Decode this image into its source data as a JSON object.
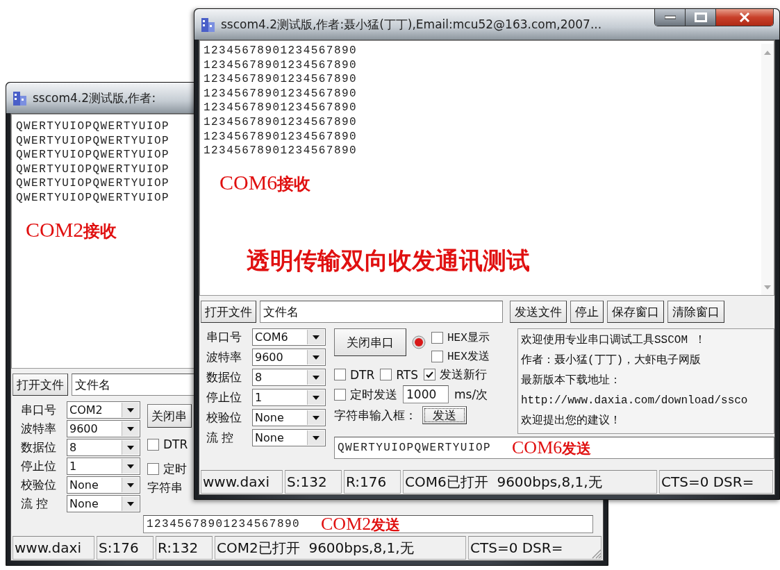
{
  "back_window": {
    "title": "sscom4.2测试版,作者:",
    "receive_lines": [
      "QWERTYUIOPQWERTYUIOP",
      "QWERTYUIOPQWERTYUIOP",
      "QWERTYUIOPQWERTYUIOP",
      "QWERTYUIOPQWERTYUIOP",
      "QWERTYUIOPQWERTYUIOP",
      "QWERTYUIOPQWERTYUIOP"
    ],
    "receive_note": "COM2**接收**",
    "open_file_button": "打开文件",
    "file_name": "文件名",
    "settings": [
      {
        "label": "串口号",
        "value": "COM2"
      },
      {
        "label": "波特率",
        "value": "9600"
      },
      {
        "label": "数据位",
        "value": "8"
      },
      {
        "label": "停止位",
        "value": "1"
      },
      {
        "label": "校验位",
        "value": "None"
      },
      {
        "label": "流 控",
        "value": "None"
      }
    ],
    "close_port_button": "关闭串",
    "checkboxes": [
      {
        "label": "DTR",
        "checked": false
      },
      {
        "label": "定时",
        "checked": false
      }
    ],
    "string_input_label": "字符串",
    "send_text": "12345678901234567890",
    "send_note": "COM2**发送**",
    "status": [
      "www.daxi",
      "S:176",
      "R:132",
      "COM2已打开  9600bps,8,1,无",
      "CTS=0 DSR="
    ]
  },
  "front_window": {
    "title": "sscom4.2测试版,作者:聂小猛(丁丁),Email:mcu52@163.com,2007...",
    "receive_lines": [
      "12345678901234567890",
      "12345678901234567890",
      "12345678901234567890",
      "12345678901234567890",
      "12345678901234567890",
      "12345678901234567890",
      "12345678901234567890",
      "12345678901234567890"
    ],
    "receive_note": "COM6**接收**",
    "banner": "透明传输双向收发通讯测试",
    "open_file_button": "打开文件",
    "file_name": "文件名",
    "file_buttons": [
      "发送文件",
      "停止",
      "保存窗口",
      "清除窗口"
    ],
    "settings": [
      {
        "label": "串口号",
        "value": "COM6"
      },
      {
        "label": "波特率",
        "value": "9600"
      },
      {
        "label": "数据位",
        "value": "8"
      },
      {
        "label": "停止位",
        "value": "1"
      },
      {
        "label": "校验位",
        "value": "None"
      },
      {
        "label": "流 控",
        "value": "None"
      }
    ],
    "close_port_button": "关闭串口",
    "port_open": true,
    "checkboxes": [
      {
        "label": "HEX显示",
        "checked": false
      },
      {
        "label": "HEX发送",
        "checked": false
      },
      {
        "label": "DTR",
        "checked": false
      },
      {
        "label": "RTS",
        "checked": false
      },
      {
        "label": "发送新行",
        "checked": true
      },
      {
        "label": "定时发送",
        "checked": false
      }
    ],
    "interval": "1000",
    "interval_unit": "ms/次",
    "string_input_label": "字符串输入框：",
    "send_button": "发送",
    "info_lines": [
      "欢迎使用专业串口调试工具SSCOM ！",
      "作者：聂小猛(丁丁)，大虾电子网版",
      "最新版本下载地址：",
      "http://www.daxia.com/download/ssco",
      "欢迎提出您的建议！"
    ],
    "send_text": "QWERTYUIOPQWERTYUIOP",
    "send_note": "COM6**发送**",
    "status": [
      "www.daxi",
      "S:132",
      "R:176",
      "COM6已打开  9600bps,8,1,无",
      "CTS=0 DSR="
    ]
  }
}
